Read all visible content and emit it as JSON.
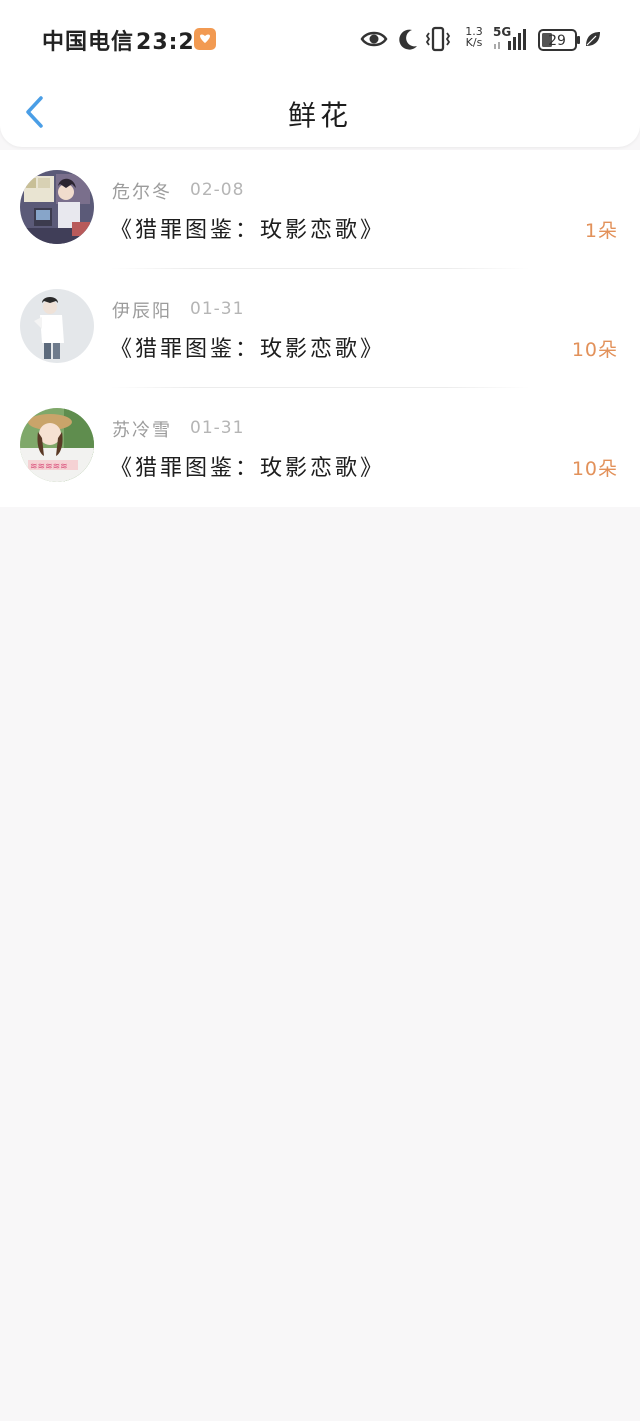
{
  "status_bar": {
    "carrier": "中国电信",
    "time": "23:25",
    "speed_value": "1.3",
    "speed_unit": "K/s",
    "network": "5G",
    "battery": "29",
    "icons": [
      "app-badge-icon",
      "eye-icon",
      "moon-icon",
      "vibrate-icon",
      "signal-icon",
      "battery-icon",
      "leaf-icon"
    ]
  },
  "nav": {
    "back_icon": "chevron-left-icon",
    "title": "鲜花"
  },
  "colors": {
    "accent_blue": "#4a9ee6",
    "count_orange": "#e2915a",
    "badge_orange": "#f29a52",
    "background": "#f8f7f8"
  },
  "items": [
    {
      "user": "危尔冬",
      "date": "02-08",
      "title": "《猎罪图鉴：玫影恋歌》",
      "count": "1朵"
    },
    {
      "user": "伊辰阳",
      "date": "01-31",
      "title": "《猎罪图鉴：玫影恋歌》",
      "count": "10朵"
    },
    {
      "user": "苏冷雪",
      "date": "01-31",
      "title": "《猎罪图鉴：玫影恋歌》",
      "count": "10朵"
    }
  ]
}
